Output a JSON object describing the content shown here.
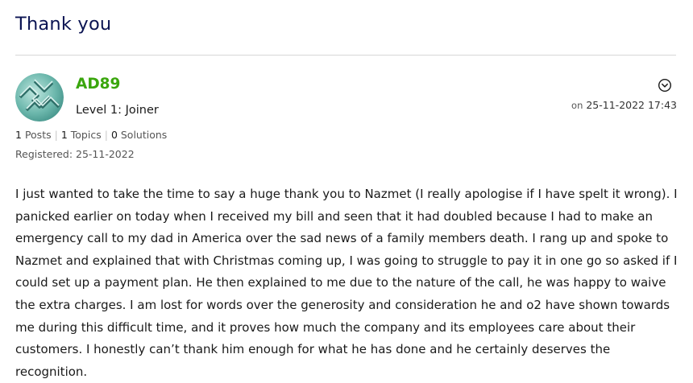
{
  "post": {
    "title": "Thank you",
    "author": {
      "username": "AD89",
      "rank": "Level 1: Joiner",
      "avatar_icon": "tech-pattern-avatar-icon"
    },
    "date": {
      "prefix": "on",
      "value": "25-11-2022 17:43"
    },
    "stats": {
      "posts_count": "1",
      "posts_label": "Posts",
      "topics_count": "1",
      "topics_label": "Topics",
      "solutions_count": "0",
      "solutions_label": "Solutions"
    },
    "registered": "Registered: 25-11-2022",
    "options_icon": "chevron-down-circle-icon",
    "body_lines": "I just wanted to take the time to say a huge thank you to Nazmet (I really apologise if I have spelt it wrong). I\npanicked earlier on today when I received my bill and seen that it had doubled because I had to make an\nemergency call to my dad in America over the sad news of a family members death. I rang up and spoke to\nNazmet and explained that with Christmas coming up, I was going to struggle to pay it in one go so asked if I\ncould set up a payment plan. He then explained to me due to the nature of the call, he was happy to waive\nthe extra charges. I am lost for words over the generosity and consideration he and o2 have shown towards\nme during this difficult time, and it proves how much the company and its employees care about their\ncustomers. I honestly can’t thank him enough for what he has done and he certainly deserves the\nrecognition."
  },
  "colors": {
    "title": "#0b1452",
    "username": "#3aa60d",
    "divider": "#d6d6d6"
  }
}
